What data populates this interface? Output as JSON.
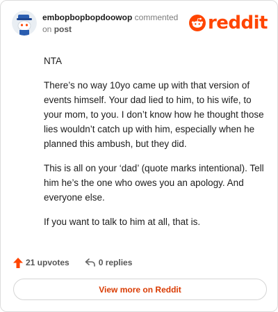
{
  "comment": {
    "username": "embopbopbopdoowop",
    "action": "commented",
    "on_word": "on",
    "post_link": "post",
    "paragraphs": [
      "NTA",
      "There’s no way 10yo came up with that version of events himself. Your dad lied to him, to his wife, to your mom, to you. I don’t know how he thought those lies wouldn’t catch up with him, especially when he planned this ambush, but they did.",
      "This is all on your ‘dad’ (quote marks intentional). Tell him he’s the one who owes you an apology. And everyone else.",
      "If you want to talk to him at all, that is."
    ]
  },
  "brand": {
    "logo_text": "reddit",
    "accent": "#ff4500"
  },
  "footer": {
    "upvotes": "21 upvotes",
    "replies": "0 replies"
  },
  "cta": {
    "label": "View more on Reddit"
  }
}
